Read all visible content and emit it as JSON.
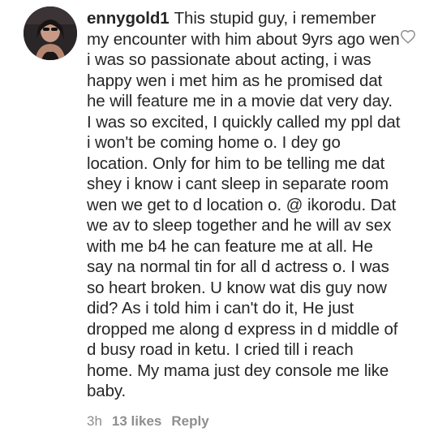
{
  "comment": {
    "username": "ennygold1",
    "text": "This stupid guy, i remember my encounter with him about 9yrs ago wen i was so passionate about acting, i was happy wen i met him as he promised dat he will feature me in a movie dat very day. I was so excited, I quickly called my ppl dat i won't be coming home o. I dey go location. Only for him to be telling me dat shey i know i cant sleep in separate room wen we get to d location o. @ ikorodu. Dat we av to sleep together and he will av sex with me b4 he can feature me at all. He say na normal tin for all d actress o. I was so heart broken. U know wat dis guy now did? As i told him i can't do it, He just dropped me along d express in d middle of d busy road in ketu. I cried till i reach home. My mama just dey console me like baby.",
    "time": "3h",
    "likes": "13 likes",
    "reply_label": "Reply"
  },
  "icons": {
    "like": "heart-outline-icon",
    "avatar": "profile-avatar"
  },
  "colors": {
    "text": "#262626",
    "meta": "#8e8e8e",
    "heart": "#8e8e8e"
  }
}
